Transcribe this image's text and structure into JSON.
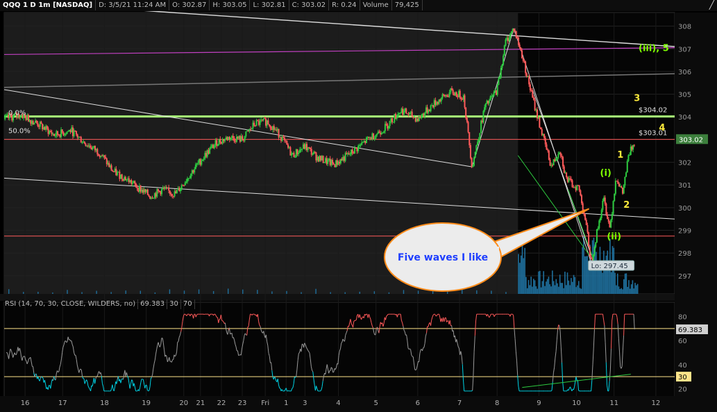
{
  "header": {
    "symbol": "QQQ 1 D 1m [NASDAQ]",
    "date": "D: 3/5/21 11:24 AM",
    "open": "O: 302.87",
    "high": "H: 303.05",
    "low": "L: 302.81",
    "close": "C: 303.02",
    "range": "R: 0.24",
    "volume_label": "Volume",
    "volume_value": "79,425"
  },
  "rsi_header": {
    "title": "RSI (14, 70, 30, CLOSE, WILDERS, no)",
    "value": "69.383",
    "lower": "30",
    "upper": "70"
  },
  "colors": {
    "up": "#2ecc40",
    "down": "#ff5a5a",
    "background": "#000000",
    "shaded_session": "#1c1c1c",
    "rsi_line": "#9a9a9a",
    "rsi_overbought": "#ff5a5a",
    "rsi_oversold": "#00d4e6",
    "fib_line": "#ffffff",
    "support_line": "#a8ff78",
    "purple_line": "#c040c0",
    "red_line": "#ff5a5a",
    "elliott_yellow": "#ffeb3b",
    "elliott_green": "#7fff00",
    "callout_fill": "#ececec",
    "callout_border": "#ff8c1a",
    "callout_text": "#1f3fff",
    "volume": "#1f6f9c"
  },
  "chart_data": {
    "type": "candlestick",
    "price_axis": {
      "min": 296.2,
      "max": 308.6,
      "ticks": [
        297,
        298,
        299,
        300,
        301,
        302,
        303,
        304,
        305,
        306,
        307,
        308
      ]
    },
    "x_axis": {
      "ticks": [
        "16",
        "17",
        "18",
        "19",
        "20",
        "21",
        "22",
        "23",
        "Fri",
        "1",
        "3",
        "4",
        "5",
        "6",
        "7",
        "8",
        "9",
        "10",
        "11",
        "12"
      ],
      "tick_times": [
        0.5,
        1.4,
        2.4,
        3.4,
        4.3,
        4.7,
        5.2,
        5.7,
        6.25,
        6.75,
        7.2,
        8.0,
        8.9,
        9.9,
        10.9,
        11.8,
        12.8,
        13.7,
        14.6,
        15.6
      ]
    },
    "price_path": [
      [
        0,
        303.9
      ],
      [
        0.4,
        304.1
      ],
      [
        0.8,
        303.7
      ],
      [
        1.2,
        303.2
      ],
      [
        1.6,
        303.4
      ],
      [
        1.9,
        302.9
      ],
      [
        2.3,
        302.4
      ],
      [
        2.6,
        301.6
      ],
      [
        2.9,
        301.3
      ],
      [
        3.2,
        300.9
      ],
      [
        3.5,
        300.5
      ],
      [
        3.8,
        300.8
      ],
      [
        4.1,
        300.6
      ],
      [
        4.5,
        301.6
      ],
      [
        4.8,
        302.3
      ],
      [
        5.1,
        302.9
      ],
      [
        5.4,
        303.1
      ],
      [
        5.7,
        303.0
      ],
      [
        6.0,
        303.7
      ],
      [
        6.3,
        303.8
      ],
      [
        6.6,
        303.2
      ],
      [
        6.9,
        302.3
      ],
      [
        7.2,
        302.7
      ],
      [
        7.5,
        302.2
      ],
      [
        7.9,
        301.9
      ],
      [
        8.3,
        302.4
      ],
      [
        8.7,
        303.0
      ],
      [
        9.1,
        303.5
      ],
      [
        9.5,
        304.3
      ],
      [
        9.9,
        303.9
      ],
      [
        10.3,
        304.6
      ],
      [
        10.7,
        305.1
      ],
      [
        11.0,
        304.9
      ],
      [
        11.2,
        301.8
      ],
      [
        11.5,
        304.4
      ],
      [
        11.8,
        305.2
      ],
      [
        12.0,
        307.3
      ],
      [
        12.2,
        307.9
      ],
      [
        12.4,
        306.7
      ],
      [
        12.65,
        304.8
      ],
      [
        12.9,
        303.1
      ],
      [
        13.1,
        301.8
      ],
      [
        13.3,
        302.6
      ],
      [
        13.45,
        301.3
      ],
      [
        13.6,
        301.0
      ],
      [
        13.75,
        300.9
      ],
      [
        13.9,
        299.6
      ],
      [
        14.05,
        297.6
      ],
      [
        14.2,
        299.0
      ],
      [
        14.35,
        300.4
      ],
      [
        14.5,
        299.1
      ],
      [
        14.65,
        301.4
      ],
      [
        14.8,
        300.6
      ],
      [
        14.95,
        302.3
      ],
      [
        15.1,
        303.0
      ]
    ],
    "volume_session_start": 12.3,
    "rsi": {
      "min": 15,
      "max": 85,
      "overbought": 70,
      "oversold": 30,
      "last": 69.383,
      "ticks": [
        20,
        40,
        60,
        80
      ]
    },
    "levels": [
      {
        "label": "$304.02",
        "price": 304.02
      },
      {
        "label": "$303.01",
        "price": 303.01
      }
    ],
    "last_price_label": "303.02",
    "rsi_last_label": "69.383",
    "rsi_oversold_label": "30",
    "low_label": "Lo: 297.45",
    "low_price": 297.45,
    "fib_labels": [
      {
        "text": "0.0%",
        "price": 304.15
      },
      {
        "text": "50.0%",
        "price": 303.35
      }
    ],
    "elliott_labels": [
      {
        "text": "(iii), 5",
        "t": 15.55,
        "price": 306.9,
        "color": "elliott_green"
      },
      {
        "text": "3",
        "t": 15.15,
        "price": 304.7,
        "color": "elliott_yellow"
      },
      {
        "text": "4",
        "t": 15.75,
        "price": 303.4,
        "color": "elliott_yellow"
      },
      {
        "text": "1",
        "t": 14.75,
        "price": 302.2,
        "color": "elliott_yellow"
      },
      {
        "text": "(i)",
        "t": 14.4,
        "price": 301.4,
        "color": "elliott_green"
      },
      {
        "text": "2",
        "t": 14.9,
        "price": 300.0,
        "color": "elliott_yellow"
      },
      {
        "text": "(ii)",
        "t": 14.6,
        "price": 298.6,
        "color": "elliott_green"
      }
    ],
    "annotation": "Five waves I like"
  }
}
